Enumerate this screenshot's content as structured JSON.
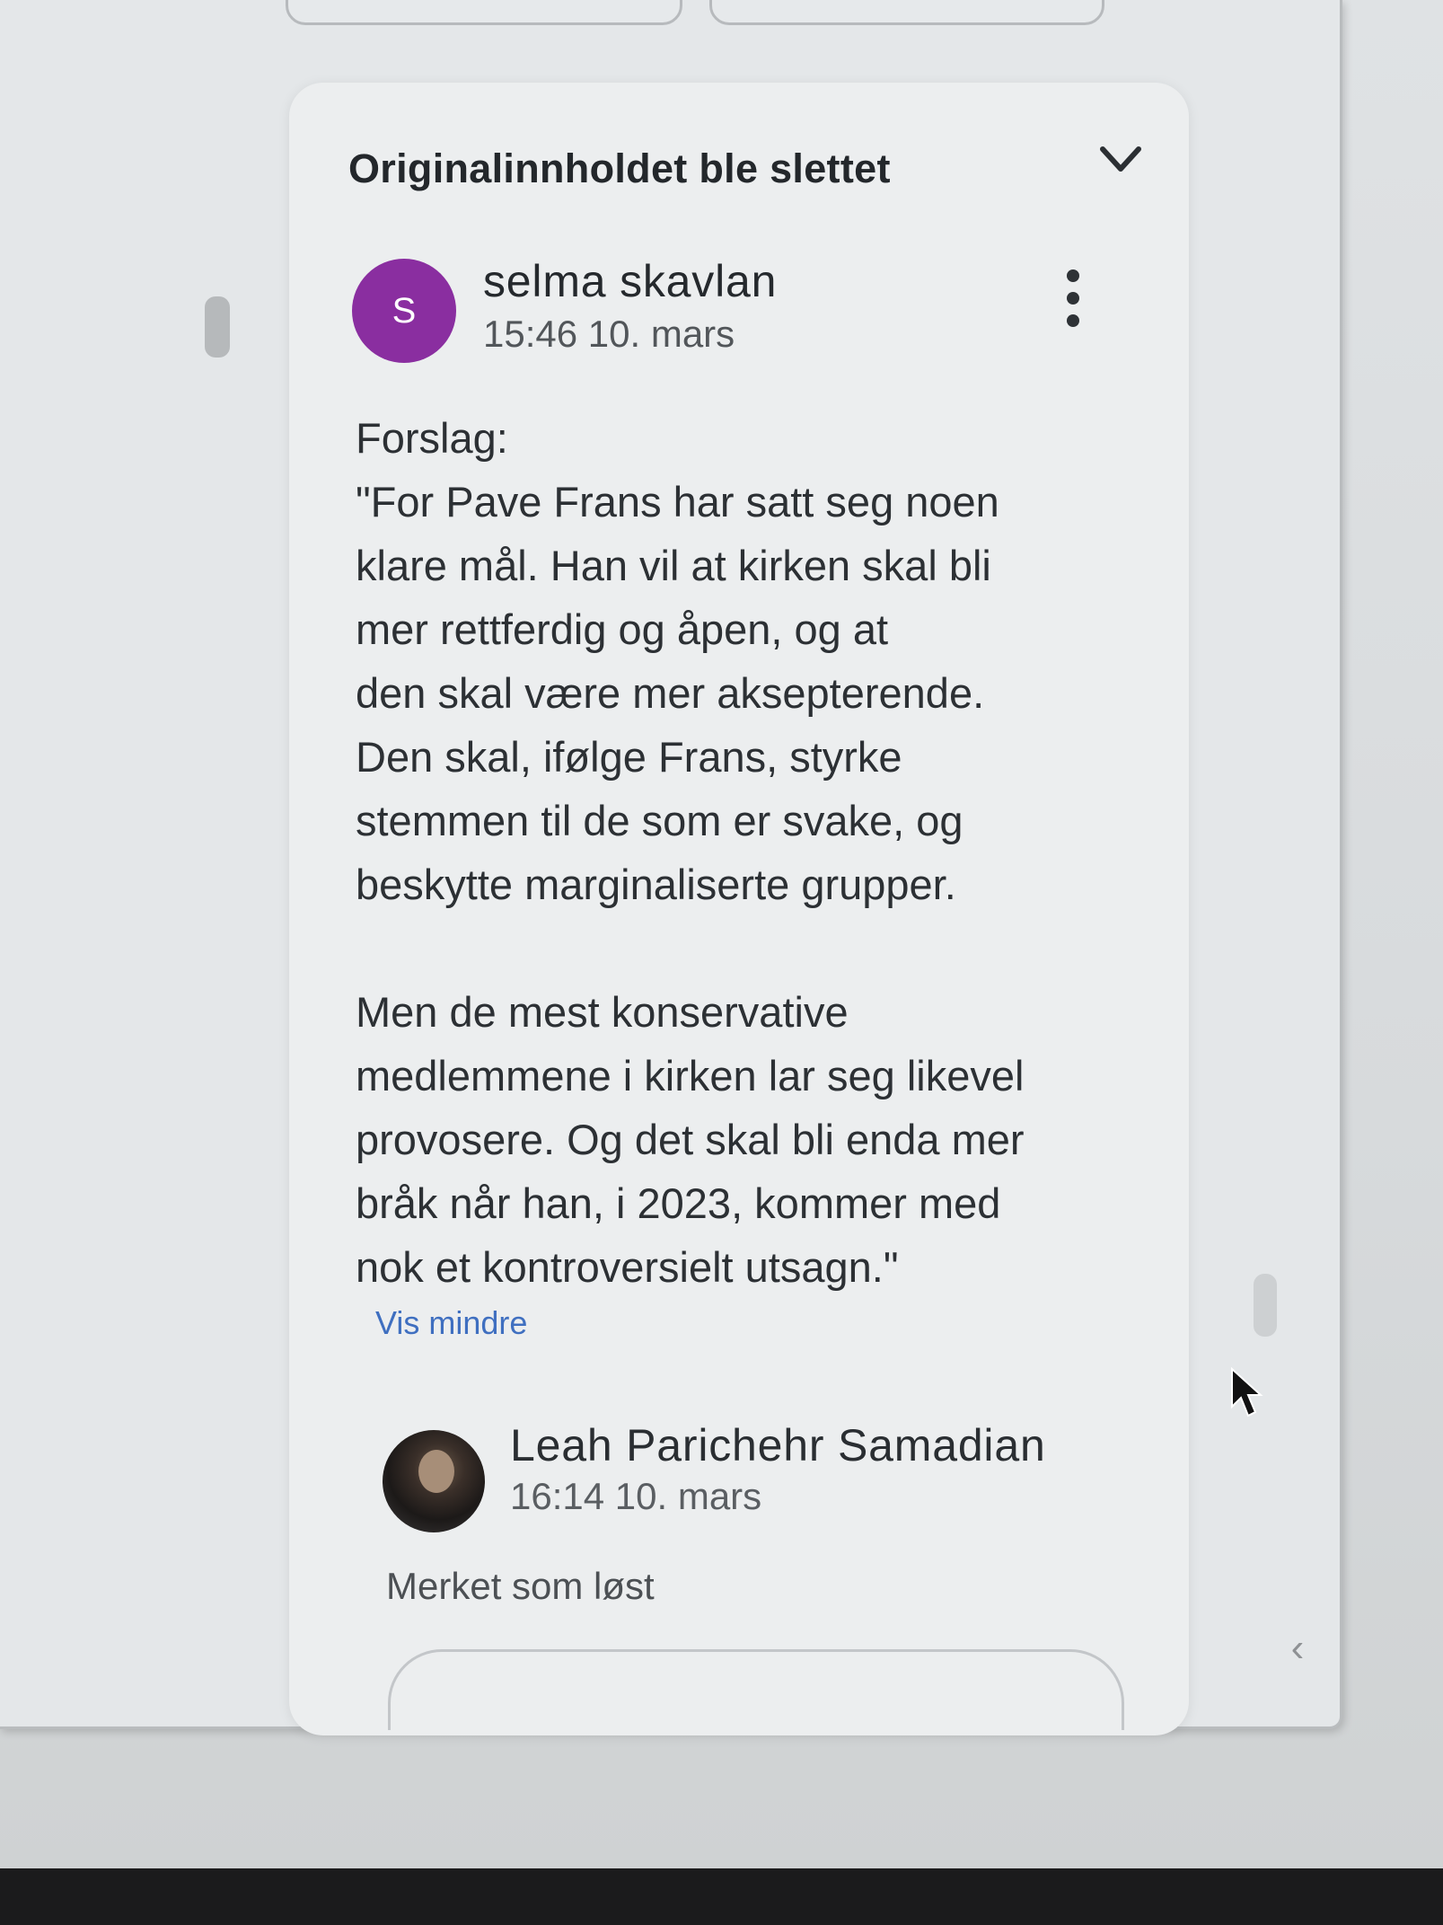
{
  "card": {
    "header": "Originalinnholdet ble slettet",
    "comment": {
      "avatar_initial": "S",
      "author": "selma skavlan",
      "time": "15:46 10. mars",
      "text": "Forslag:\n\"For Pave Frans har satt seg noen\nklare mål. Han vil at kirken skal bli\nmer rettferdig og åpen, og at\nden skal være mer aksepterende.\nDen skal, ifølge Frans, styrke\nstemmen til de som er svake, og\nbeskytte marginaliserte grupper.\n\nMen de mest konservative\nmedlemmene i kirken lar seg likevel\nprovosere. Og det skal bli enda mer\nbråk når han, i 2023, kommer med\nnok et kontroversielt utsagn.\"",
      "show_less": "Vis mindre"
    },
    "reply": {
      "author": "Leah Parichehr Samadian",
      "time": "16:14 10. mars",
      "status": "Merket som løst"
    }
  },
  "colors": {
    "avatar": "#8a2ea0",
    "link": "#3f6fc0"
  },
  "icons": [
    "chevron-down-icon",
    "more-vert-icon",
    "chevron-left-icon",
    "mouse-cursor-icon"
  ]
}
